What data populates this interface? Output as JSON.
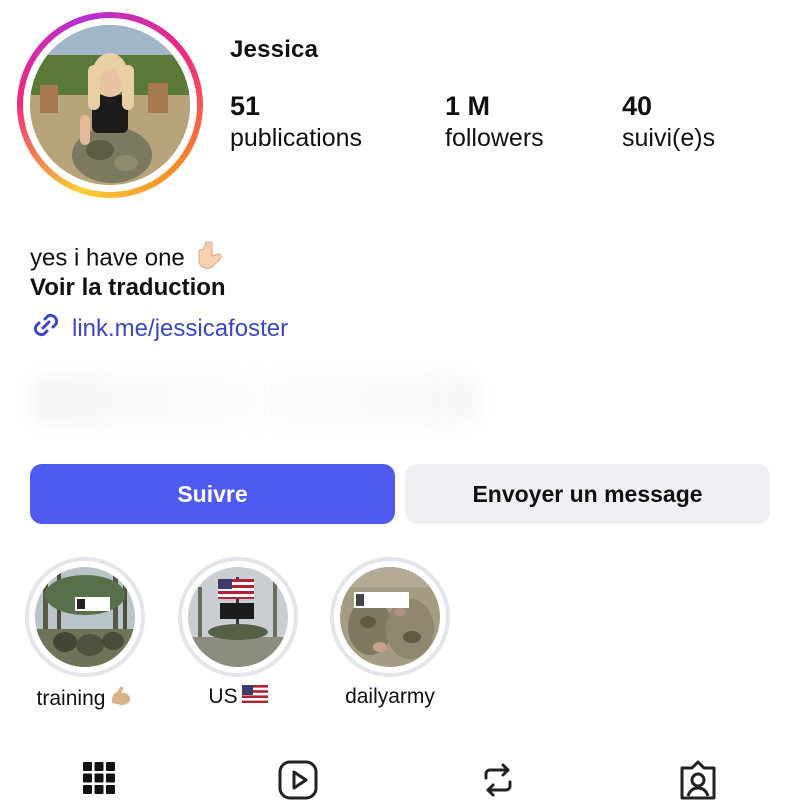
{
  "profile": {
    "username": "Jessica",
    "stats": {
      "posts_count": "51",
      "posts_label": "publications",
      "followers_count": "1 M",
      "followers_label": "followers",
      "following_count": "40",
      "following_label": "suivi(e)s"
    },
    "bio": {
      "text": "yes i have one",
      "text_emoji_icon": "pointing-down-hand-icon",
      "translate_label": "Voir la traduction",
      "link_icon": "link-icon",
      "link_text": "link.me/jessicafoster"
    }
  },
  "actions": {
    "follow_label": "Suivre",
    "message_label": "Envoyer un message",
    "follow_color": "#4f5bf0",
    "message_bg_color": "#eef0f4"
  },
  "highlights": [
    {
      "label": "training",
      "emoji_icon": "flexed-biceps-icon"
    },
    {
      "label": "US",
      "emoji_icon": "us-flag-icon"
    },
    {
      "label": "dailyarmy",
      "emoji_icon": ""
    }
  ],
  "tabs": [
    {
      "icon": "grid-icon"
    },
    {
      "icon": "reels-icon"
    },
    {
      "icon": "repost-icon"
    },
    {
      "icon": "tagged-icon"
    }
  ]
}
